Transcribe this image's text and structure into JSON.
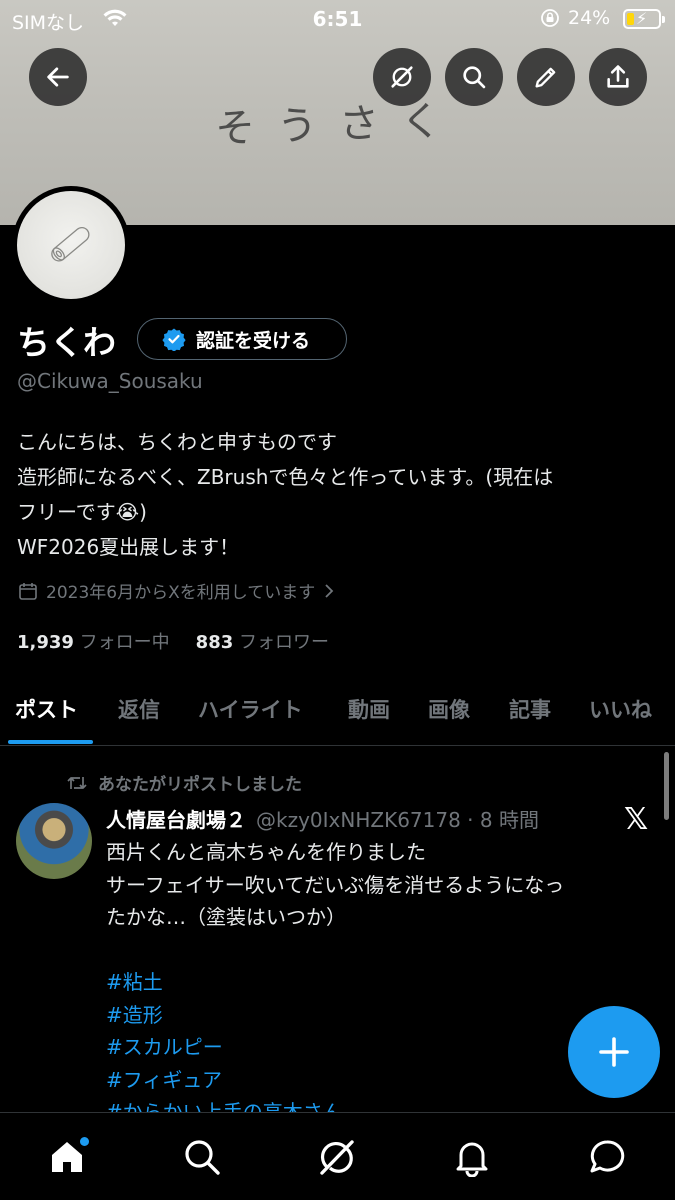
{
  "status_bar": {
    "carrier": "SIMなし",
    "time": "6:51",
    "battery_percent": "24%",
    "battery_level": 0.24,
    "battery_fill_color": "#ffd60a"
  },
  "banner": {
    "handwritten_text": "そうさく"
  },
  "header_buttons": {
    "back": "arrow-left-icon",
    "grok": "grok-icon",
    "search": "search-icon",
    "edit": "pencil-icon",
    "share": "share-icon"
  },
  "profile": {
    "display_name": "ちくわ",
    "verify_button_label": "認証を受ける",
    "handle": "@Cikuwa_Sousaku",
    "bio_lines": [
      "こんにちは、ちくわと申すものです",
      "造形師になるべく、ZBrushで色々と作っています。(現在は",
      "フリーです😭)",
      "WF2026夏出展します！"
    ],
    "joined": "2023年6月からXを利用しています",
    "following_count": "1,939",
    "following_label": "フォロー中",
    "followers_count": "883",
    "followers_label": "フォロワー"
  },
  "tabs": [
    {
      "label": "ポスト",
      "active": true
    },
    {
      "label": "返信",
      "active": false
    },
    {
      "label": "ハイライト",
      "active": false
    },
    {
      "label": "動画",
      "active": false
    },
    {
      "label": "画像",
      "active": false
    },
    {
      "label": "記事",
      "active": false
    },
    {
      "label": "いいね",
      "active": false
    }
  ],
  "post": {
    "repost_label": "あなたがリポストしました",
    "author_name": "人情屋台劇場２",
    "author_meta": "@kzy0IxNHZK67178 · 8 時間",
    "body_lines": [
      "西片くんと高木ちゃんを作りました",
      "サーフェイサー吹いてだいぶ傷を消せるようになっ",
      "たかな…（塗装はいつか）"
    ],
    "hashtags": [
      "#粘土",
      "#造形",
      "#スカルピー",
      "#フィギュア",
      "#からかい上手の高木さん"
    ]
  },
  "colors": {
    "accent": "#1d9bf0",
    "background": "#000000",
    "muted_text": "#71767b"
  },
  "bottom_nav": [
    "home-icon",
    "search-icon",
    "grok-icon",
    "notifications-icon",
    "messages-icon"
  ]
}
